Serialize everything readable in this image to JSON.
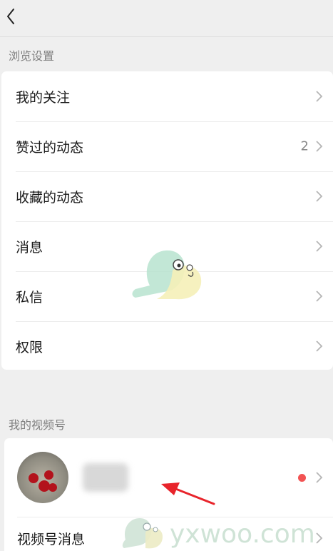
{
  "header": {
    "back_icon": "chevron-left-icon"
  },
  "browse_settings": {
    "title": "浏览设置",
    "items": [
      {
        "label": "我的关注",
        "count": null
      },
      {
        "label": "赞过的动态",
        "count": "2"
      },
      {
        "label": "收藏的动态",
        "count": null
      },
      {
        "label": "消息",
        "count": null
      },
      {
        "label": "私信",
        "count": null
      },
      {
        "label": "权限",
        "count": null
      }
    ]
  },
  "my_channel": {
    "title": "我的视频号",
    "profile": {
      "avatar_icon": "cherry-avatar",
      "has_notification": true
    },
    "message_item": {
      "label": "视频号消息"
    }
  },
  "watermark": {
    "text": "yxwoo.com"
  },
  "colors": {
    "background": "#efefef",
    "card": "#ffffff",
    "label_grey": "#7f7f7f",
    "badge_red": "#f25353",
    "annotation_red": "#e8242b",
    "watermark_green": "#cfe3d6"
  }
}
